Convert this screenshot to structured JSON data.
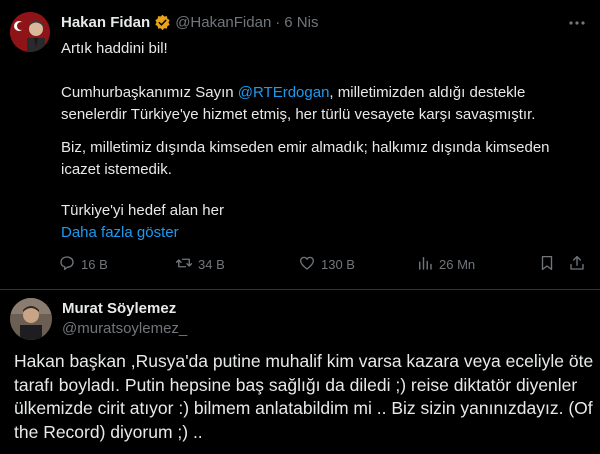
{
  "tweet1": {
    "name": "Hakan Fidan",
    "handle": "@HakanFidan",
    "separator": "·",
    "date": "6 Nis",
    "line1": "Artık haddini bil!",
    "para2_before": "Cumhurbaşkanımız Sayın ",
    "para2_mention": "@RTErdogan",
    "para2_after": ", milletimizden aldığı destekle senelerdir Türkiye'ye hizmet etmiş, her türlü vesayete karşı savaşmıştır.",
    "para3": "Biz, milletimiz dışında kimseden emir almadık; halkımız dışında kimseden icazet istemedik.",
    "para4": "Türkiye'yi hedef alan her",
    "show_more": "Daha fazla göster",
    "stats": {
      "replies": "16 B",
      "reposts": "34 B",
      "likes": "130 B",
      "views": "26 Mn"
    },
    "icons": [
      "verified-badge",
      "more-icon",
      "reply-icon",
      "repost-icon",
      "like-icon",
      "views-icon",
      "bookmark-icon",
      "share-icon"
    ],
    "accent": "#1d9bf0",
    "badge_color": "#e8a317"
  },
  "tweet2": {
    "name": "Murat Söylemez",
    "handle": "@muratsoylemez_",
    "text": "Hakan başkan ,Rusya'da putine muhalif kim varsa kazara veya eceliyle öte tarafı boyladı. Putin hepsine baş sağlığı da diledi ;) reise diktatör diyenler ülkemizde cirit atıyor   :) bilmem anlatabildim mi .. Biz sizin yanınızdayız. (Of the Record) diyorum   ;) .."
  }
}
